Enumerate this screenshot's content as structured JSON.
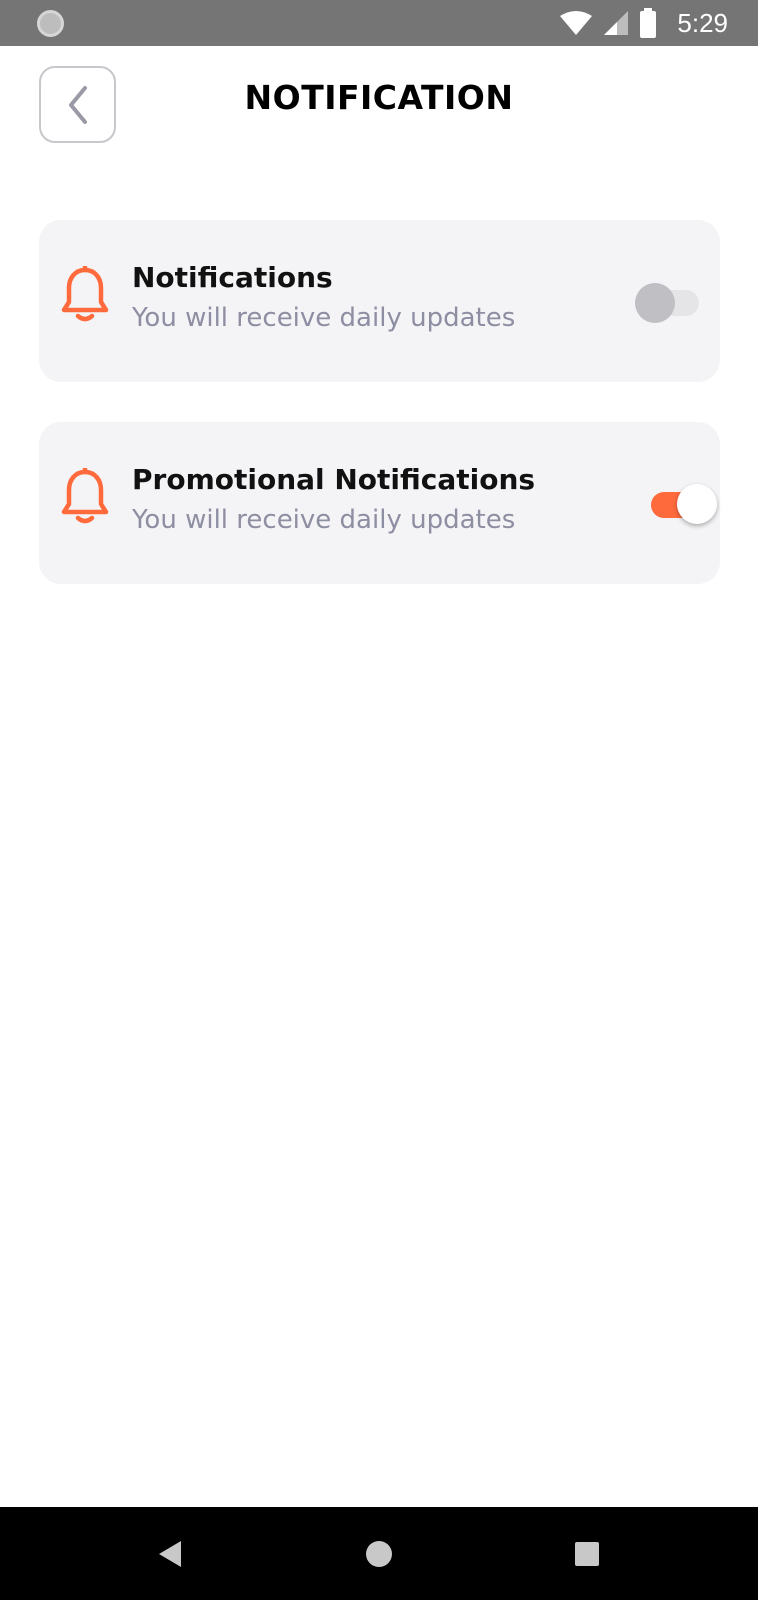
{
  "status_bar": {
    "time": "5:29",
    "icons": [
      "sync-indicator-icon",
      "wifi-icon",
      "cellular-signal-icon",
      "battery-icon"
    ]
  },
  "header": {
    "title": "NOTIFICATION",
    "back_icon": "chevron-left-icon"
  },
  "settings": [
    {
      "icon": "bell-icon",
      "title": "Notifications",
      "subtitle": "You will receive daily updates",
      "enabled": false
    },
    {
      "icon": "bell-icon",
      "title": "Promotional Notifications",
      "subtitle": "You will receive daily updates",
      "enabled": true
    }
  ],
  "navigation_bar": {
    "buttons": [
      "back-triangle-icon",
      "home-circle-icon",
      "recents-square-icon"
    ]
  },
  "colors": {
    "accent": "#ff6a3d",
    "card_background": "#f4f4f6",
    "subtitle_text": "#8e8ea3",
    "status_bar": "#757575"
  }
}
